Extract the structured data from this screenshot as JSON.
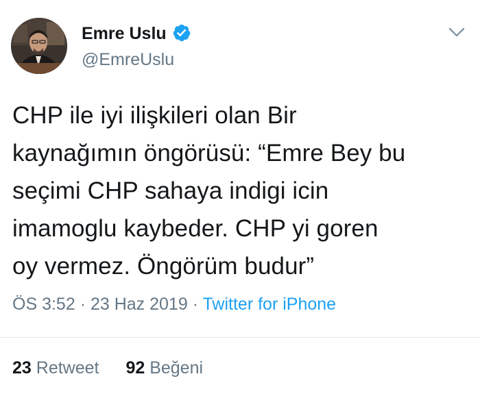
{
  "author": {
    "display_name": "Emre Uslu",
    "handle": "@EmreUslu",
    "verified": true,
    "avatar_icon": "profile-photo"
  },
  "tweet": {
    "text": "CHP ile iyi ilişkileri olan Bir\nkaynağımın öngörüsü:  “Emre Bey bu\nseçimi CHP sahaya indigi icin\nimamoglu kaybeder. CHP yi goren\noy vermez. Öngörüm budur”",
    "time": "ÖS 3:52",
    "date": "23 Haz 2019",
    "separator": "·",
    "source": "Twitter for iPhone"
  },
  "stats": {
    "retweets_count": "23",
    "retweets_label": "Retweet",
    "likes_count": "92",
    "likes_label": "Beğeni"
  },
  "icons": {
    "verified": "verified-badge-icon",
    "caret": "chevron-down-icon"
  },
  "colors": {
    "text": "#14171a",
    "secondary": "#657786",
    "link": "#1da1f2",
    "verified": "#1da1f2",
    "divider": "#e1e8ed"
  }
}
